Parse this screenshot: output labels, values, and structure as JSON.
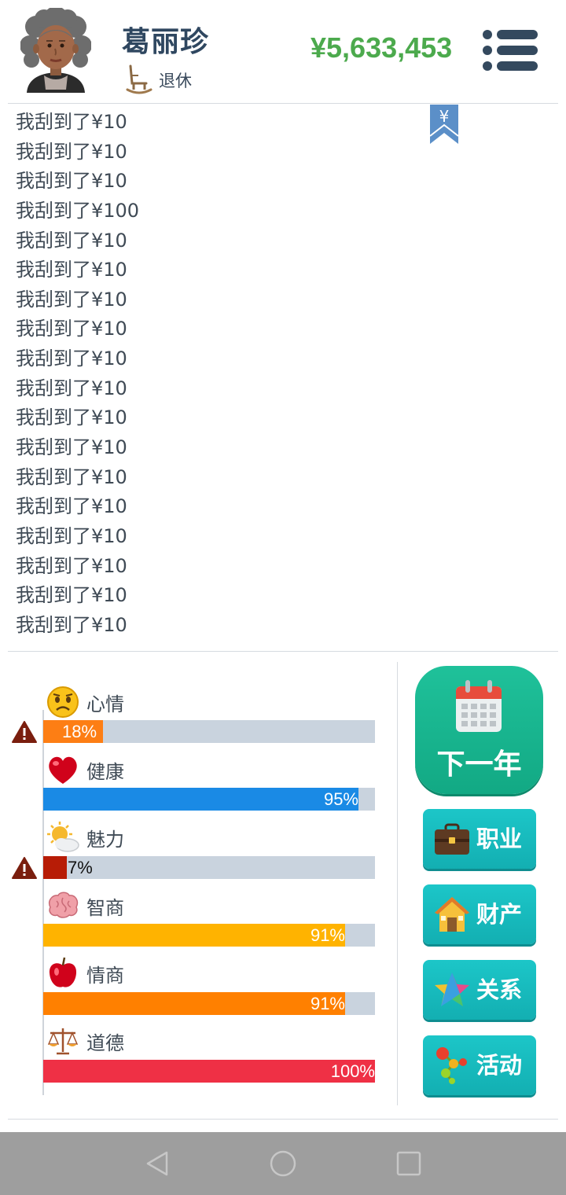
{
  "header": {
    "name": "葛丽珍",
    "status": "退休",
    "money": "¥5,633,453",
    "avatar_icon": "elderly-woman-avatar",
    "status_icon": "rocking-chair-icon",
    "menu_icon": "menu-list-icon"
  },
  "log": {
    "bookmark_icon": "yen-bookmark-icon",
    "bookmark_symbol": "¥",
    "lines": [
      "我刮到了¥10",
      "我刮到了¥10",
      "我刮到了¥10",
      "我刮到了¥100",
      "我刮到了¥10",
      "我刮到了¥10",
      "我刮到了¥10",
      "我刮到了¥10",
      "我刮到了¥10",
      "我刮到了¥10",
      "我刮到了¥10",
      "我刮到了¥10",
      "我刮到了¥10",
      "我刮到了¥10",
      "我刮到了¥10",
      "我刮到了¥10",
      "我刮到了¥10",
      "我刮到了¥10"
    ]
  },
  "stats": [
    {
      "label": "心情",
      "value": 18,
      "text": "18%",
      "color": "#fd7e14",
      "icon": "sad-face-icon",
      "warning": true
    },
    {
      "label": "健康",
      "value": 95,
      "text": "95%",
      "color": "#1a8ae5",
      "icon": "heart-icon",
      "warning": false
    },
    {
      "label": "魅力",
      "value": 7,
      "text": "7%",
      "color": "#b71c06",
      "icon": "sun-cloud-icon",
      "warning": true
    },
    {
      "label": "智商",
      "value": 91,
      "text": "91%",
      "color": "#ffb300",
      "icon": "brain-icon",
      "warning": false
    },
    {
      "label": "情商",
      "value": 91,
      "text": "91%",
      "color": "#ff8000",
      "icon": "apple-icon",
      "warning": false
    },
    {
      "label": "道德",
      "value": 100,
      "text": "100%",
      "color": "#ef3045",
      "icon": "scales-icon",
      "warning": false
    }
  ],
  "actions": {
    "next_year": "下一年",
    "career": "职业",
    "assets": "财产",
    "relationships": "关系",
    "activities": "活动"
  },
  "colors": {
    "money": "#4caa4d",
    "next_button": "#12a984",
    "action_button": "#13afb2"
  }
}
